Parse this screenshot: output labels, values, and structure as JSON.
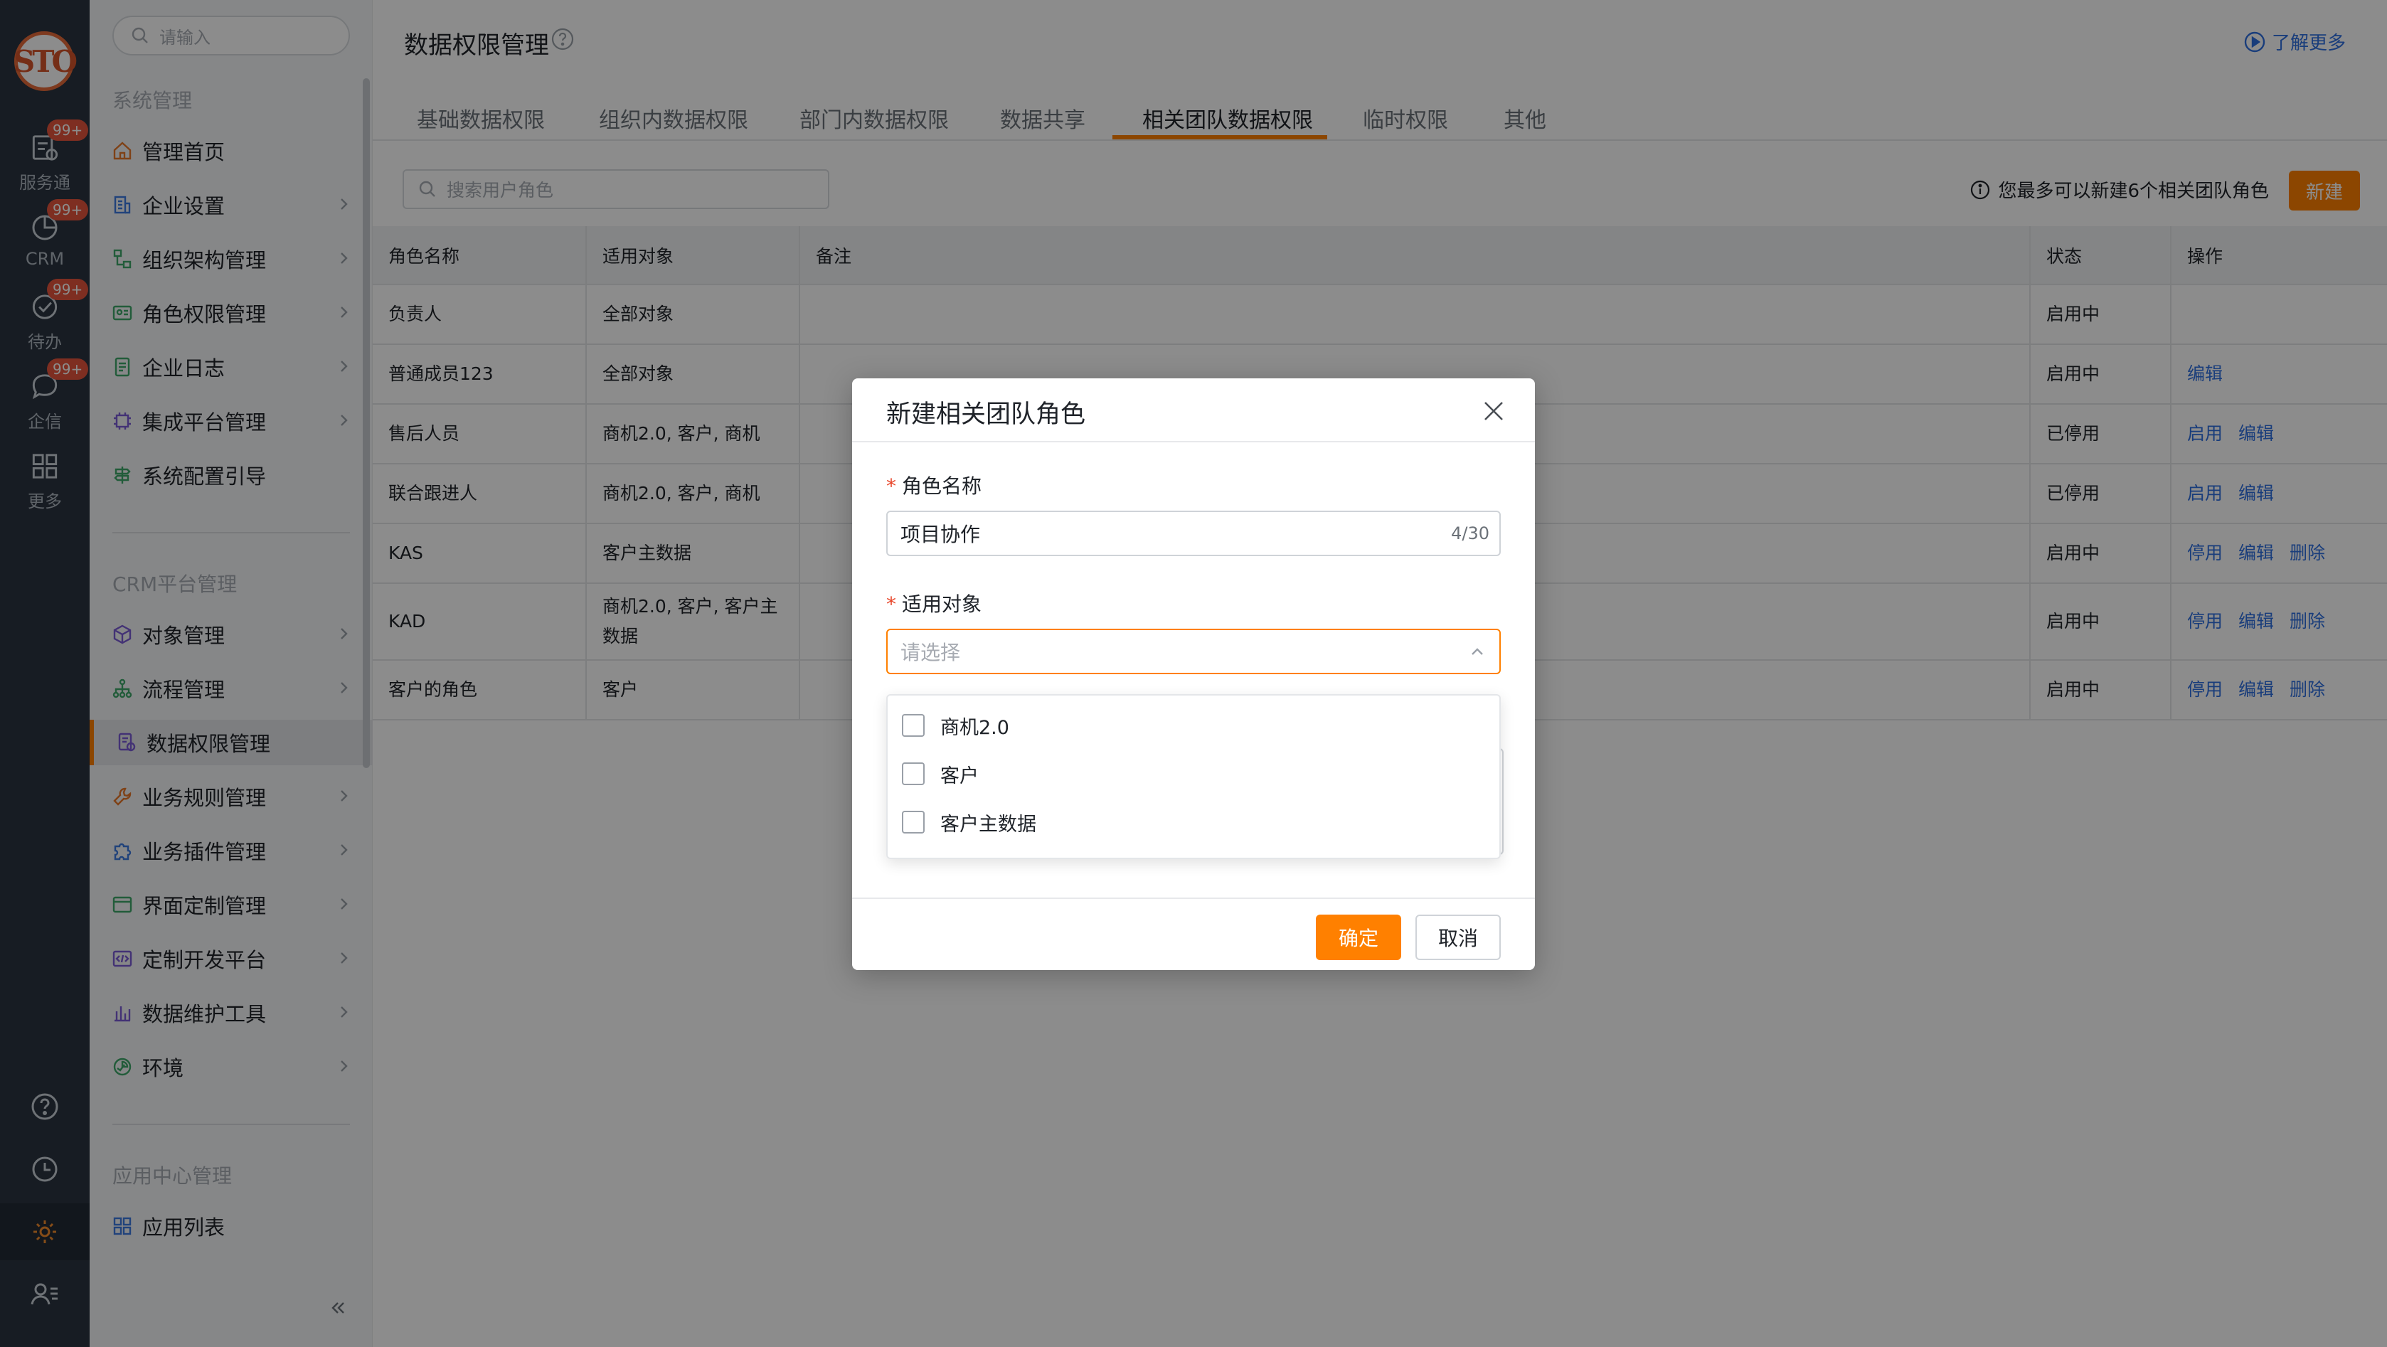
{
  "rail": {
    "items": [
      {
        "label": "服务通",
        "badge": "99+",
        "icon": "service-icon"
      },
      {
        "label": "CRM",
        "badge": "99+",
        "icon": "pie-icon"
      },
      {
        "label": "待办",
        "badge": "99+",
        "icon": "check-circle-icon"
      },
      {
        "label": "企信",
        "badge": "99+",
        "icon": "chat-icon"
      },
      {
        "label": "更多",
        "icon": "grid-icon"
      }
    ],
    "bottom_icons": [
      "help-icon",
      "clock-icon",
      "gear-icon",
      "user-list-icon"
    ]
  },
  "sidebar": {
    "search_placeholder": "请输入",
    "sections": [
      {
        "title": "系统管理"
      },
      {
        "title": "CRM平台管理"
      },
      {
        "title": "应用中心管理"
      }
    ],
    "items": [
      {
        "label": "管理首页",
        "icon": "home-icon"
      },
      {
        "label": "企业设置",
        "icon": "building-icon"
      },
      {
        "label": "组织架构管理",
        "icon": "org-icon"
      },
      {
        "label": "角色权限管理",
        "icon": "id-card-icon"
      },
      {
        "label": "企业日志",
        "icon": "log-icon"
      },
      {
        "label": "集成平台管理",
        "icon": "chip-icon"
      },
      {
        "label": "系统配置引导",
        "icon": "signpost-icon"
      },
      {
        "label": "对象管理",
        "icon": "cube-icon"
      },
      {
        "label": "流程管理",
        "icon": "flow-icon"
      },
      {
        "label": "数据权限管理",
        "icon": "data-lock-icon"
      },
      {
        "label": "业务规则管理",
        "icon": "wrench-icon"
      },
      {
        "label": "业务插件管理",
        "icon": "puzzle-icon"
      },
      {
        "label": "界面定制管理",
        "icon": "window-icon"
      },
      {
        "label": "定制开发平台",
        "icon": "code-icon"
      },
      {
        "label": "数据维护工具",
        "icon": "bar-chart-icon"
      },
      {
        "label": "环境",
        "icon": "env-icon"
      },
      {
        "label": "应用列表",
        "icon": "apps-icon"
      }
    ]
  },
  "header": {
    "title": "数据权限管理",
    "learn_more": "了解更多"
  },
  "tabs": [
    "基础数据权限",
    "组织内数据权限",
    "部门内数据权限",
    "数据共享",
    "相关团队数据权限",
    "临时权限",
    "其他"
  ],
  "active_tab": "相关团队数据权限",
  "toolbar": {
    "search_placeholder": "搜索用户角色",
    "limit_note": "您最多可以新建6个相关团队角色",
    "new_button": "新建"
  },
  "table": {
    "columns": [
      "角色名称",
      "适用对象",
      "备注",
      "状态",
      "操作"
    ],
    "rows": [
      {
        "name": "负责人",
        "target": "全部对象",
        "note": "",
        "status": "启用中",
        "ops": []
      },
      {
        "name": "普通成员123",
        "target": "全部对象",
        "note": "",
        "status": "启用中",
        "ops": [
          "编辑"
        ]
      },
      {
        "name": "售后人员",
        "target": "商机2.0, 客户, 商机",
        "note": "",
        "status": "已停用",
        "ops": [
          "启用",
          "编辑"
        ]
      },
      {
        "name": "联合跟进人",
        "target": "商机2.0, 客户, 商机",
        "note": "",
        "status": "已停用",
        "ops": [
          "启用",
          "编辑"
        ]
      },
      {
        "name": "KAS",
        "target": "客户主数据",
        "note": "",
        "status": "启用中",
        "ops": [
          "停用",
          "编辑",
          "删除"
        ]
      },
      {
        "name": "KAD",
        "target": "商机2.0, 客户, 客户主数据",
        "note": "",
        "status": "启用中",
        "ops": [
          "停用",
          "编辑",
          "删除"
        ]
      },
      {
        "name": "客户的角色",
        "target": "客户",
        "note": "",
        "status": "启用中",
        "ops": [
          "停用",
          "编辑",
          "删除"
        ]
      }
    ]
  },
  "dialog": {
    "title": "新建相关团队角色",
    "name_label": "角色名称",
    "name_value": "项目协作",
    "name_count": "4/30",
    "target_label": "适用对象",
    "target_placeholder": "请选择",
    "options": [
      "商机2.0",
      "客户",
      "客户主数据"
    ],
    "ok": "确定",
    "cancel": "取消"
  }
}
